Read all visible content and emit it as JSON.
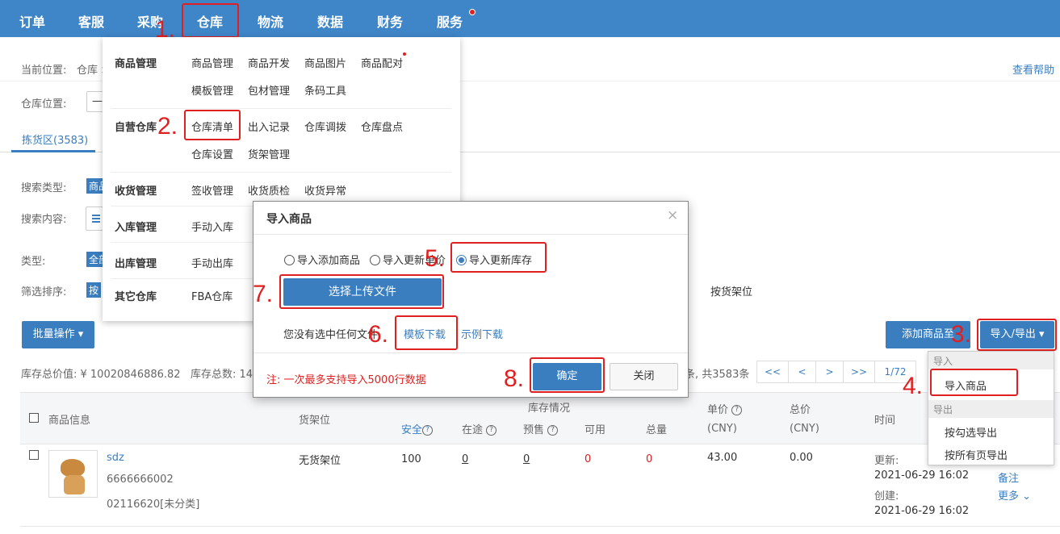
{
  "nav": {
    "items": [
      "订单",
      "客服",
      "采购",
      "仓库",
      "物流",
      "数据",
      "财务",
      "服务"
    ]
  },
  "breadcrumb": {
    "label": "当前位置:",
    "path": "仓库 >"
  },
  "help_link": "查看帮助",
  "warehouse_position": {
    "label": "仓库位置:",
    "value": "—"
  },
  "tab_active": "拣货区(3583)",
  "filters": {
    "search_type_label": "搜索类型:",
    "search_type_value": "商品",
    "search_content_label": "搜索内容:",
    "type_label": "类型:",
    "type_value": "全部",
    "sort_label": "筛选排序:",
    "sort_value": "按",
    "sort_option_shelf": "按货架位"
  },
  "toolbar": {
    "batch": "批量操作",
    "add_goods_to": "添加商品至",
    "import_export": "导入/导出"
  },
  "summary": {
    "total_value": "库存总价值: ¥ 10020846886.82",
    "total_count": "库存总数: 144",
    "total_records": "条, 共3583条"
  },
  "pagination": {
    "first": "<<",
    "prev": "<",
    "next": ">",
    "last": ">>",
    "page": "1/72"
  },
  "dropdown_menu": {
    "import_header": "导入",
    "import_goods": "导入商品",
    "export_header": "导出",
    "export_checked": "按勾选导出",
    "export_all": "按所有页导出"
  },
  "mega_menu": {
    "rows": [
      {
        "title": "商品管理",
        "links": [
          "商品管理",
          "商品开发",
          "商品图片",
          "商品配对",
          "模板管理",
          "包材管理",
          "条码工具"
        ]
      },
      {
        "title": "自营仓库",
        "links": [
          "仓库清单",
          "出入记录",
          "仓库调拨",
          "仓库盘点",
          "仓库设置",
          "货架管理"
        ]
      },
      {
        "title": "收货管理",
        "links": [
          "签收管理",
          "收货质检",
          "收货异常"
        ]
      },
      {
        "title": "入库管理",
        "links": [
          "手动入库"
        ]
      },
      {
        "title": "出库管理",
        "links": [
          "手动出库"
        ]
      },
      {
        "title": "其它仓库",
        "links": [
          "FBA仓库"
        ]
      }
    ]
  },
  "dialog": {
    "title": "导入商品",
    "close": "×",
    "options": [
      "导入添加商品",
      "导入更新单价",
      "导入更新库存"
    ],
    "selected_option": "导入更新库存",
    "upload": "选择上传文件",
    "no_file": "您没有选中任何文件",
    "template_download": "模板下载",
    "sample_download": "示例下载",
    "note": "注: 一次最多支持导入5000行数据",
    "confirm": "确定",
    "cancel": "关闭"
  },
  "table": {
    "headers": {
      "product_info": "商品信息",
      "shelf": "货架位",
      "stock_status": "库存情况",
      "safe": "安全",
      "in_transit": "在途",
      "presale": "预售",
      "available": "可用",
      "total": "总量",
      "unit_price": "单价",
      "unit_price_cny": "(CNY)",
      "total_price": "总价",
      "total_price_cny": "(CNY)",
      "time": "时间"
    },
    "rows": [
      {
        "name": "sdz",
        "sku": "6666666002",
        "code": "02116620[未分类]",
        "shelf": "无货架位",
        "safe": "100",
        "in_transit": "0",
        "presale": "0",
        "available": "0",
        "total": "0",
        "unit_price": "43.00",
        "total_price": "0.00",
        "updated_label": "更新:",
        "updated": "2021-06-29 16:02",
        "created_label": "创建:",
        "created": "2021-06-29 16:02",
        "remark": "备注",
        "more": "更多"
      }
    ]
  },
  "steps": [
    "1.",
    "2.",
    "3.",
    "4.",
    "5.",
    "6.",
    "7.",
    "8."
  ],
  "colors": {
    "nav": "#3f86c8",
    "accent": "#3a7ec0",
    "annotation": "#e02020"
  }
}
